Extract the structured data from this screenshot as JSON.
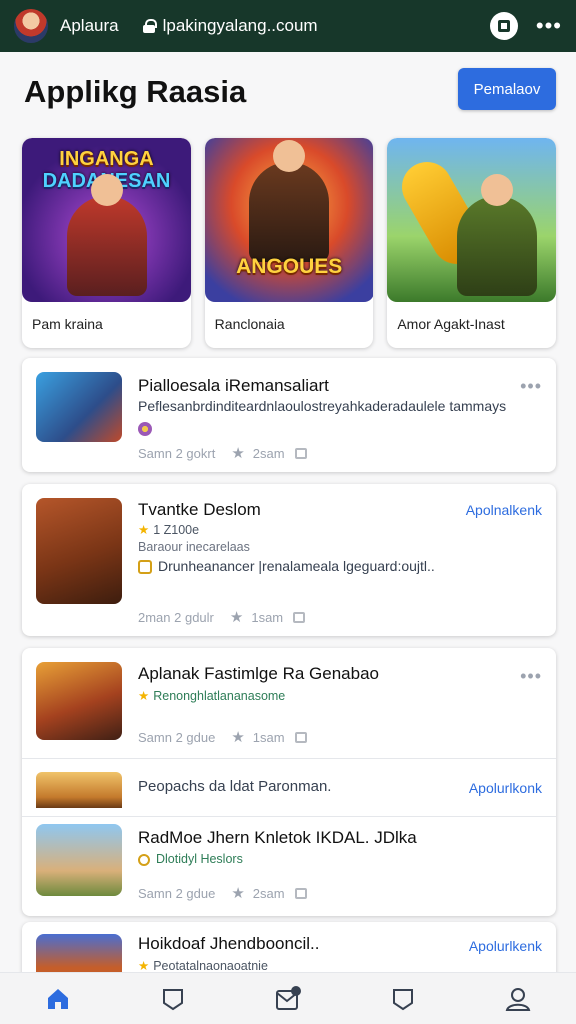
{
  "browser": {
    "app_name": "Aplaura",
    "url": "lpakingyalang..coum"
  },
  "page": {
    "heading": "Applikg Raasia",
    "primary_button": "Pemalaov"
  },
  "featured": [
    {
      "art_text_1": "INGANGA",
      "art_text_2": "DADANESAN",
      "label": "Pam kraina"
    },
    {
      "art_text_1": "ANGOUES",
      "label": "Ranclonaia"
    },
    {
      "label": "Amor Agakt-Inast"
    }
  ],
  "list": [
    {
      "title": "Pialloesala iRemansaliart",
      "description": "Peflesanbrdinditeardnlaoulostreyahkaderadaulele tammays",
      "meta_left": "Samn 2 gokrt",
      "meta_right": "2sam"
    },
    {
      "title": "Tvantke Deslom",
      "rating_text": "1 Z100e",
      "subtitle": "Baraour inecarelaas",
      "note": "Drunheanancer |renalameala lgeguard:oujtl..",
      "link": "Apolnalkenk",
      "meta_left": "2man 2 gdulr",
      "meta_right": "1sam"
    },
    {
      "title": "Aplanak Fastimlge Ra Genabao",
      "subtitle": "Renonghlatlananasome",
      "meta_left": "Samn 2 gdue",
      "meta_right": "1sam",
      "extra_line": "Peopachs da ldat Paronman.",
      "link": "Apolurlkonk"
    },
    {
      "title": "RadMoe Jhern Knletok IKDAL. JDlka",
      "subtitle": "Dlotidyl Heslors",
      "meta_left": "Samn 2 gdue",
      "meta_right": "2sam"
    },
    {
      "title": "Hoikdoaf Jhendbooncil..",
      "subtitle": "Peotatalnaonaoatnie",
      "link": "Apolurlkenk"
    }
  ]
}
